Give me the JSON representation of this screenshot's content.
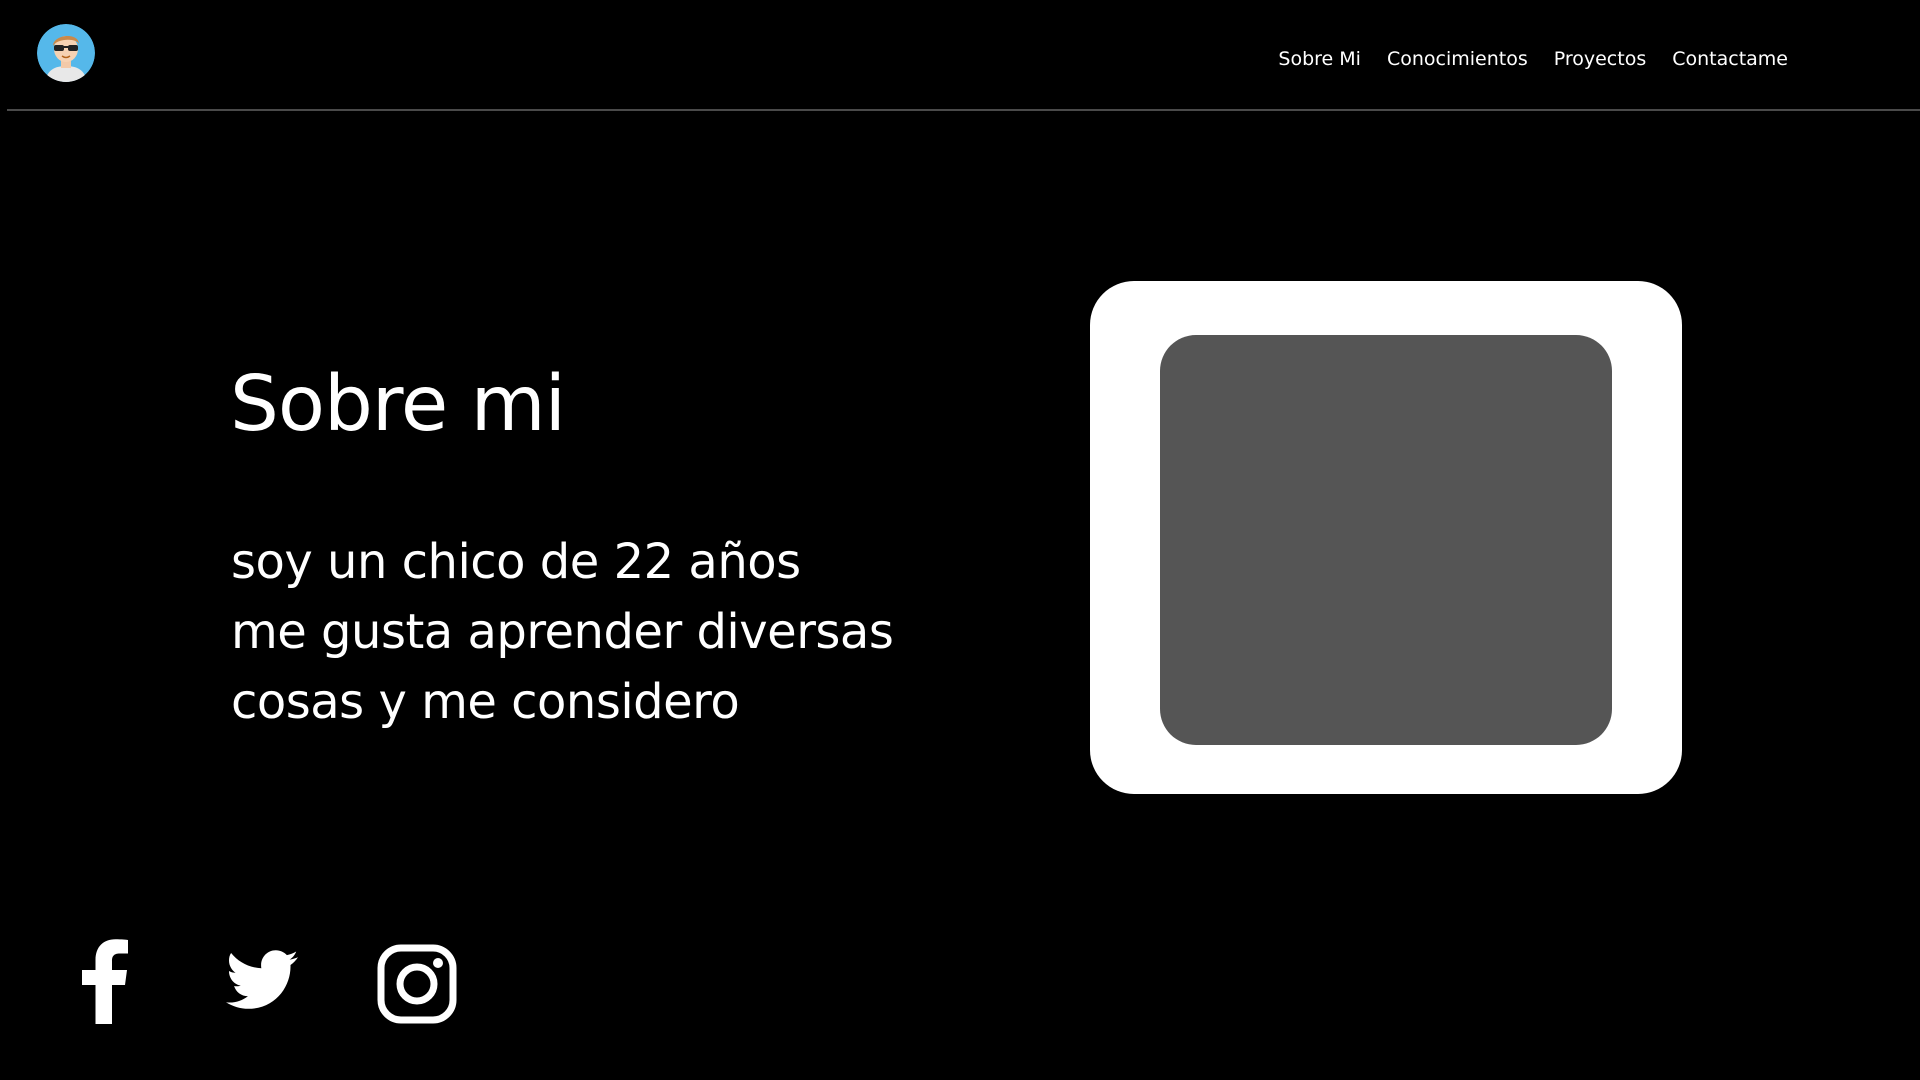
{
  "header": {
    "avatar_icon": "avatar-sunglasses-icon",
    "nav": [
      {
        "label": "Sobre Mi"
      },
      {
        "label": "Conocimientos"
      },
      {
        "label": "Proyectos"
      },
      {
        "label": "Contactame"
      }
    ]
  },
  "hero": {
    "title": "Sobre mi",
    "lines": [
      "soy un chico de 22 años",
      "me gusta aprender diversas",
      "cosas y me considero"
    ]
  },
  "media": {
    "frame_color": "#ffffff",
    "inner_color": "#555555"
  },
  "socials": [
    {
      "icon": "facebook-icon"
    },
    {
      "icon": "twitter-icon"
    },
    {
      "icon": "instagram-icon"
    }
  ],
  "colors": {
    "background": "#000000",
    "text": "#ffffff",
    "divider": "#4a4a4a",
    "avatar_bg": "#4fb3e8"
  }
}
